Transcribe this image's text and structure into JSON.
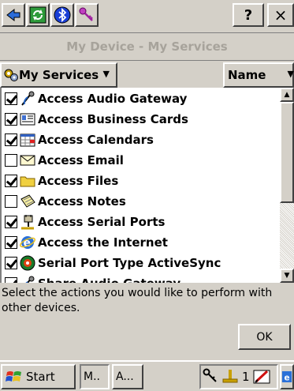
{
  "toolbar": {
    "help_label": "?",
    "close_label": "×"
  },
  "title": "My Device - My Services",
  "header": {
    "services_label": "My Services",
    "sort_label": "Name"
  },
  "list": {
    "items": [
      {
        "label": "Access Audio Gateway",
        "checked": true,
        "icon": "headset-icon"
      },
      {
        "label": "Access Business Cards",
        "checked": true,
        "icon": "business-card-icon"
      },
      {
        "label": "Access Calendars",
        "checked": true,
        "icon": "calendar-icon"
      },
      {
        "label": "Access Email",
        "checked": false,
        "icon": "envelope-icon"
      },
      {
        "label": "Access Files",
        "checked": true,
        "icon": "folder-icon"
      },
      {
        "label": "Access Notes",
        "checked": false,
        "icon": "notepad-icon"
      },
      {
        "label": "Access Serial Ports",
        "checked": true,
        "icon": "serial-plug-icon"
      },
      {
        "label": "Access the Internet",
        "checked": true,
        "icon": "internet-explorer-icon"
      },
      {
        "label": "Serial Port Type ActiveSync",
        "checked": true,
        "icon": "activesync-icon"
      },
      {
        "label": "Share Audio Gateway",
        "checked": true,
        "icon": "headset-icon"
      }
    ]
  },
  "description": "Select the actions you would like to perform with other devices.",
  "ok_label": "OK",
  "taskbar": {
    "start_label": "Start",
    "task1_label": "M..",
    "task2_label": "A...",
    "tray_number": "1"
  }
}
